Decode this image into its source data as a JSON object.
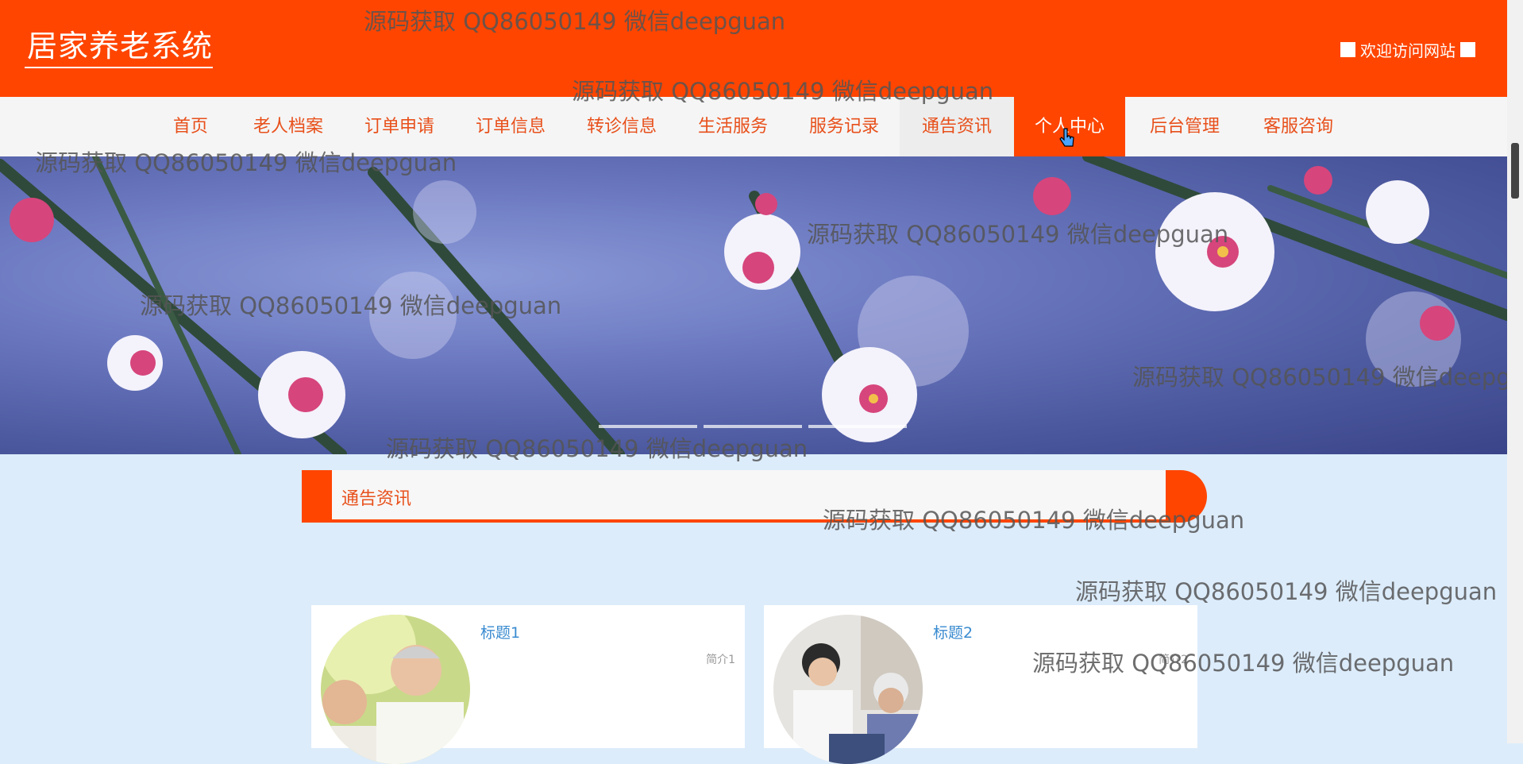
{
  "header": {
    "title": "居家养老系统",
    "welcome": "欢迎访问网站",
    "bg_color": "#ff4500"
  },
  "nav": {
    "items": [
      {
        "label": "首页"
      },
      {
        "label": "老人档案"
      },
      {
        "label": "订单申请"
      },
      {
        "label": "订单信息"
      },
      {
        "label": "转诊信息"
      },
      {
        "label": "生活服务"
      },
      {
        "label": "服务记录"
      },
      {
        "label": "通告资讯"
      },
      {
        "label": "个人中心"
      },
      {
        "label": "后台管理"
      },
      {
        "label": "客服咨询"
      }
    ],
    "active": "个人中心",
    "hovered": "通告资讯"
  },
  "banner": {
    "slides": 3,
    "active_slide": 1
  },
  "section": {
    "title": "通告资讯"
  },
  "cards": [
    {
      "title": "标题1",
      "intro": "简介1"
    },
    {
      "title": "标题2",
      "intro": "简介2"
    }
  ],
  "watermark": "源码获取 QQ86050149 微信deepguan"
}
